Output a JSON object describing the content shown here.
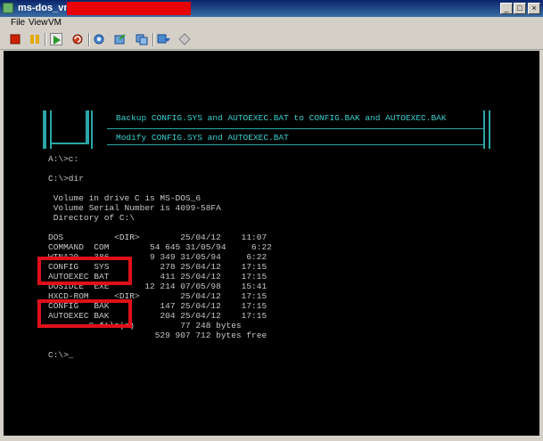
{
  "window": {
    "title": "ms-dos_vm_0"
  },
  "menu": [
    "File",
    "View",
    "VM"
  ],
  "toolbar": {
    "buttons": [
      "stop-icon",
      "pause-icon",
      "play-icon",
      "reset-icon",
      "snapshot-icon",
      "revert-icon",
      "snapshot-manager-icon",
      "ctrl-alt-del-icon",
      "settings-icon"
    ],
    "colors": {
      "stop": "#cc2200",
      "pause": "#e6a800",
      "play": "#2a9a2a"
    }
  },
  "console": {
    "dialog": [
      "Backup CONFIG.SYS and AUTOEXEC.BAT to CONFIG.BAK and AUTOEXEC.BAK",
      "Modify CONFIG.SYS and AUTOEXEC.BAT"
    ],
    "lines": [
      "A:\\>c:",
      "",
      "C:\\>dir",
      "",
      " Volume in drive C is MS-DOS_6",
      " Volume Serial Number is 4099-58FA",
      " Directory of C:\\",
      "",
      "DOS          <DIR>        25/04/12    11:07",
      "COMMAND  COM        54 645 31/05/94     6:22",
      "WINA20   386        9 349 31/05/94     6:22",
      "CONFIG   SYS          278 25/04/12    17:15",
      "AUTOEXEC BAT          411 25/04/12    17:15",
      "DOSIDLE  EXE       12 214 07/05/98    15:41",
      "HXCD-ROM     <DIR>        25/04/12    17:15",
      "CONFIG   BAK          147 25/04/12    17:15",
      "AUTOEXEC BAK          204 25/04/12    17:15",
      "        9 file(s)         77 248 bytes",
      "                     529 907 712 bytes free",
      "",
      "C:\\>_"
    ],
    "highlight_color": "#e0101a"
  }
}
